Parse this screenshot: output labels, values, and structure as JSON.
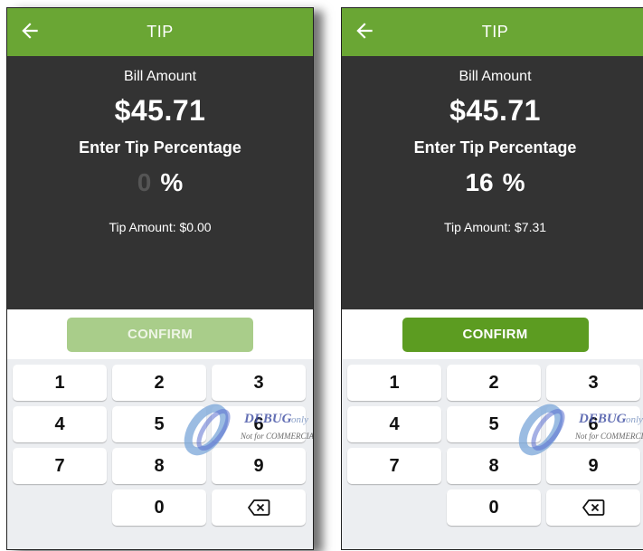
{
  "screens": [
    {
      "title": "TIP",
      "bill_label": "Bill Amount",
      "bill_amount": "$45.71",
      "enter_label": "Enter Tip Percentage",
      "tip_percentage": "0",
      "percent_symbol": "%",
      "tip_amount_text": "Tip Amount: $0.00",
      "confirm_label": "CONFIRM",
      "confirm_enabled": false,
      "keypad": [
        "1",
        "2",
        "3",
        "4",
        "5",
        "6",
        "7",
        "8",
        "9",
        "",
        "0",
        "backspace-icon"
      ],
      "watermark": {
        "main": "DEBUG",
        "suffix": "only",
        "sub": "Not for COMMERCIAL"
      }
    },
    {
      "title": "TIP",
      "bill_label": "Bill Amount",
      "bill_amount": "$45.71",
      "enter_label": "Enter Tip Percentage",
      "tip_percentage": "16",
      "percent_symbol": "%",
      "tip_amount_text": "Tip Amount: $7.31",
      "confirm_label": "CONFIRM",
      "confirm_enabled": true,
      "keypad": [
        "1",
        "2",
        "3",
        "4",
        "5",
        "6",
        "7",
        "8",
        "9",
        "",
        "0",
        "backspace-icon"
      ],
      "watermark": {
        "main": "DEBUG",
        "suffix": "only",
        "sub": "Not for COMMERCIAL"
      }
    }
  ],
  "colors": {
    "appbar": "#6aa634",
    "panel": "#333333",
    "confirm_enabled": "#5c9c21",
    "confirm_disabled": "#a9cd8a",
    "keypad_bg": "#eceef1"
  }
}
